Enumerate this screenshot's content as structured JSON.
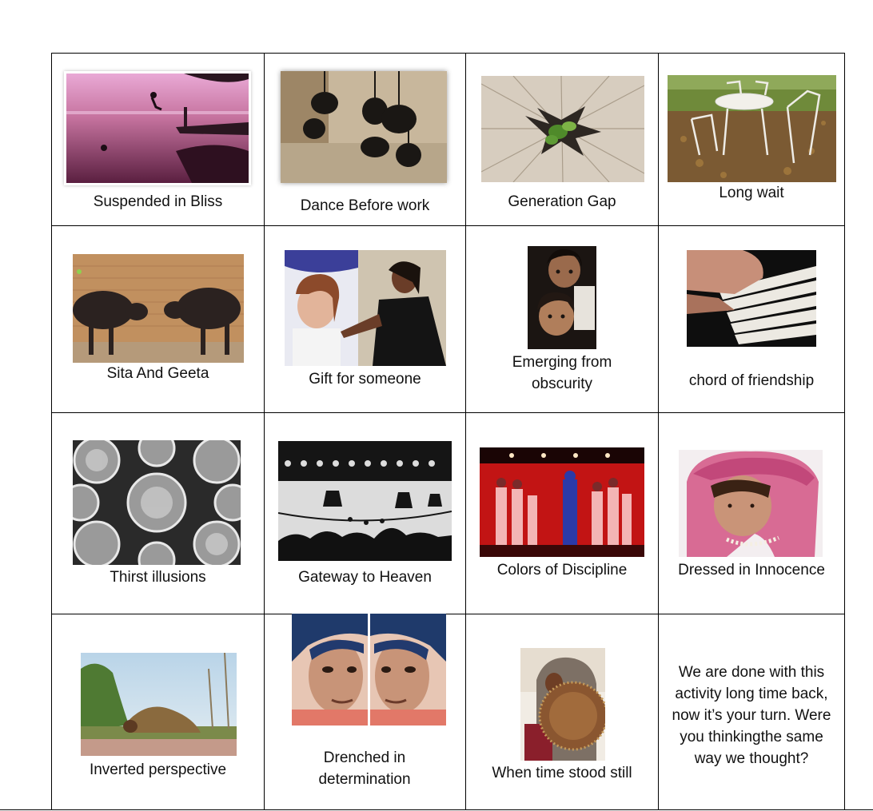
{
  "cells": [
    {
      "caption": "Suspended in Bliss",
      "image": "lake-jump-photo"
    },
    {
      "caption": "Dance Before work",
      "image": "hanging-kettles-photo"
    },
    {
      "caption": "Generation Gap",
      "image": "tree-stump-sprout-photo"
    },
    {
      "caption": "Long wait",
      "image": "garden-chairs-photo"
    },
    {
      "caption": "Sita And Geeta",
      "image": "buffaloes-photo"
    },
    {
      "caption": "Gift for someone",
      "image": "girl-with-poster-photo"
    },
    {
      "caption": "Emerging from obscurity",
      "image": "children-portrait-photo"
    },
    {
      "caption": "chord of friendship",
      "image": "piano-keys-photo"
    },
    {
      "caption": "Thirst illusions",
      "image": "glasses-photo"
    },
    {
      "caption": "Gateway to Heaven",
      "image": "temple-bells-photo"
    },
    {
      "caption": "Colors of Discipline",
      "image": "stage-performers-photo"
    },
    {
      "caption": "Dressed in Innocence",
      "image": "pink-veil-girl-photo"
    },
    {
      "caption": "Inverted perspective",
      "image": "ground-pose-photo"
    },
    {
      "caption": "Drenched in determination",
      "image": "mirrored-face-photo"
    },
    {
      "caption": "When time stood still",
      "image": "man-with-wheel-photo"
    }
  ],
  "closing_note": "We are done with this activity long time back, now it’s your turn. Were you thinkingthe same way we thought?"
}
